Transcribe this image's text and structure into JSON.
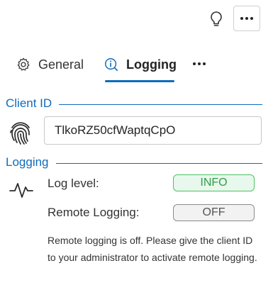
{
  "toolbar": {
    "hint_icon": "lightbulb-icon",
    "more_icon": "more-horizontal-icon"
  },
  "tabs": [
    {
      "label": "General",
      "icon": "gear-icon",
      "active": false
    },
    {
      "label": "Logging",
      "icon": "info-icon",
      "active": true
    }
  ],
  "tabs_overflow_icon": "more-horizontal-icon",
  "client_id": {
    "section_label": "Client ID",
    "icon": "fingerprint-icon",
    "value": "TlkoRZ50cfWaptqCpO"
  },
  "logging": {
    "section_label": "Logging",
    "icon": "pulse-icon",
    "log_level_label": "Log level:",
    "log_level_value": "INFO",
    "remote_logging_label": "Remote Logging:",
    "remote_logging_value": "OFF",
    "note": "Remote logging is off. Please give the client ID to your administrator to activate remote logging."
  },
  "colors": {
    "accent": "#0f6cbd",
    "info_border": "#4ec264",
    "info_text": "#2f9e44",
    "off_border": "#8a8a8a"
  }
}
